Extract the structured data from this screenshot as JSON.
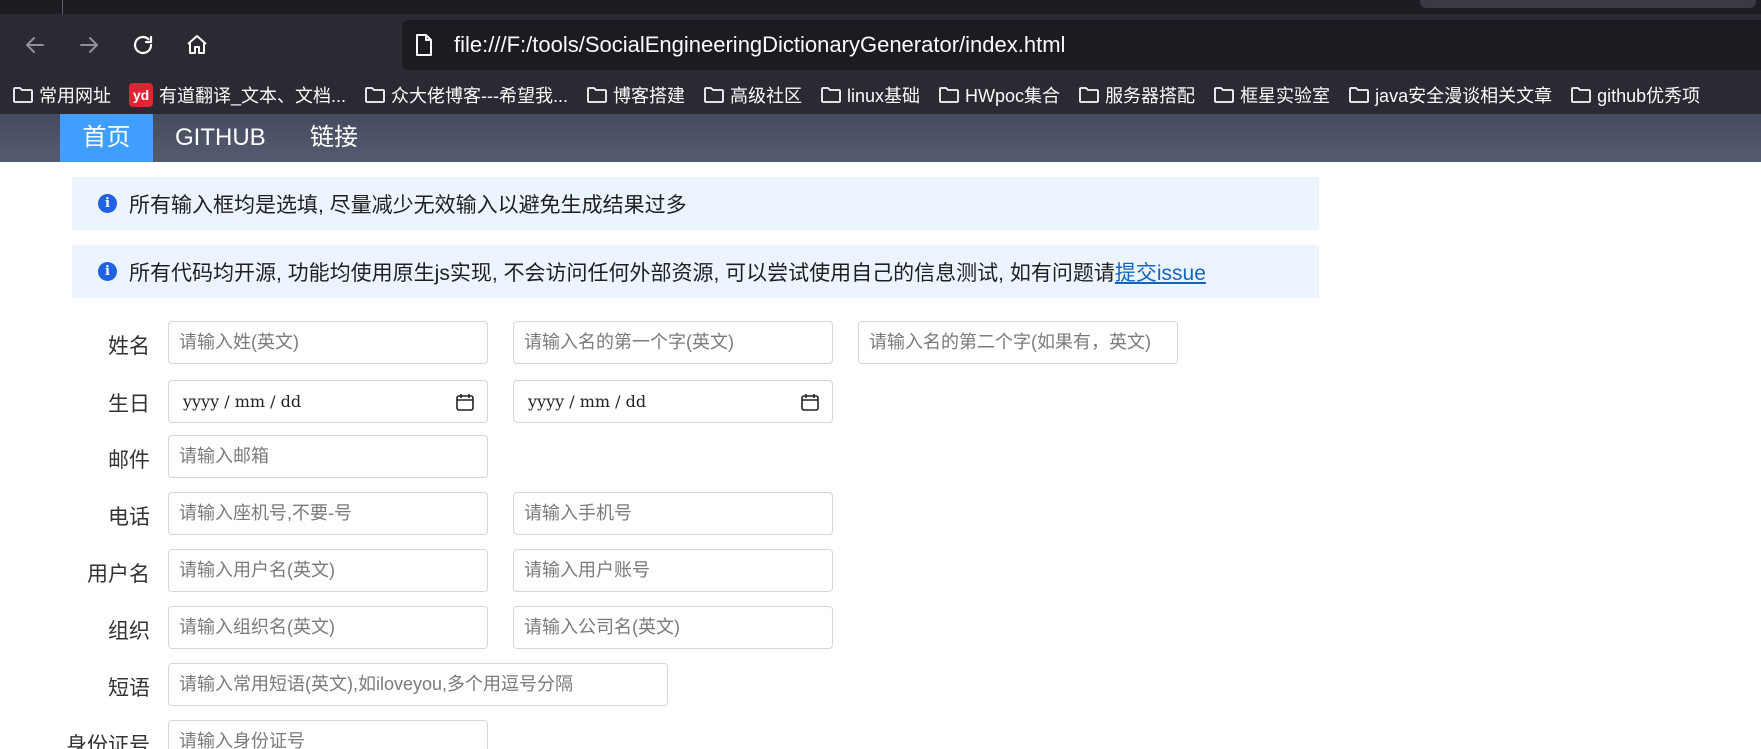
{
  "browser": {
    "url": "file:///F:/tools/SocialEngineeringDictionaryGenerator/index.html",
    "bookmarks": [
      {
        "label": "常用网址",
        "icon": "folder-icon"
      },
      {
        "label": "有道翻译_文本、文档...",
        "icon": "youdao-icon",
        "badge": "yd"
      },
      {
        "label": "众大佬博客---希望我...",
        "icon": "folder-icon"
      },
      {
        "label": "博客搭建",
        "icon": "folder-icon"
      },
      {
        "label": "高级社区",
        "icon": "folder-icon"
      },
      {
        "label": "linux基础",
        "icon": "folder-icon"
      },
      {
        "label": "HWpoc集合",
        "icon": "folder-icon"
      },
      {
        "label": "服务器搭配",
        "icon": "folder-icon"
      },
      {
        "label": "框星实验室",
        "icon": "folder-icon"
      },
      {
        "label": "java安全漫谈相关文章",
        "icon": "folder-icon"
      },
      {
        "label": "github优秀项",
        "icon": "folder-icon"
      }
    ]
  },
  "site_nav": {
    "items": [
      {
        "label": "首页",
        "active": true
      },
      {
        "label": "GITHUB",
        "active": false
      },
      {
        "label": "链接",
        "active": false
      }
    ]
  },
  "alerts": {
    "first": "所有输入框均是选填, 尽量减少无效输入以避免生成结果过多",
    "second": "所有代码均开源, 功能均使用原生js实现, 不会访问任何外部资源, 可以尝试使用自己的信息测试, 如有问题请",
    "second_link": "提交issue"
  },
  "form": {
    "name": {
      "label": "姓名",
      "surname_placeholder": "请输入姓(英文)",
      "first_char_placeholder": "请输入名的第一个字(英文)",
      "second_char_placeholder": "请输入名的第二个字(如果有，英文)"
    },
    "birthday": {
      "label": "生日",
      "date1": "yyyy / mm / dd",
      "date2": "yyyy / mm / dd"
    },
    "email": {
      "label": "邮件",
      "placeholder": "请输入邮箱"
    },
    "phone": {
      "label": "电话",
      "landline_placeholder": "请输入座机号,不要-号",
      "mobile_placeholder": "请输入手机号"
    },
    "username": {
      "label": "用户名",
      "username_placeholder": "请输入用户名(英文)",
      "account_placeholder": "请输入用户账号"
    },
    "org": {
      "label": "组织",
      "org_placeholder": "请输入组织名(英文)",
      "company_placeholder": "请输入公司名(英文)"
    },
    "phrase": {
      "label": "短语",
      "placeholder": "请输入常用短语(英文),如iloveyou,多个用逗号分隔"
    },
    "idcard": {
      "label": "身份证号",
      "placeholder": "请输入身份证号"
    }
  },
  "colors": {
    "chrome_bg": "#2b2a33",
    "url_bg": "#1c1b22",
    "nav_active": "#409eff",
    "alert_bg": "#ecf5ff",
    "link": "#1565c0"
  }
}
